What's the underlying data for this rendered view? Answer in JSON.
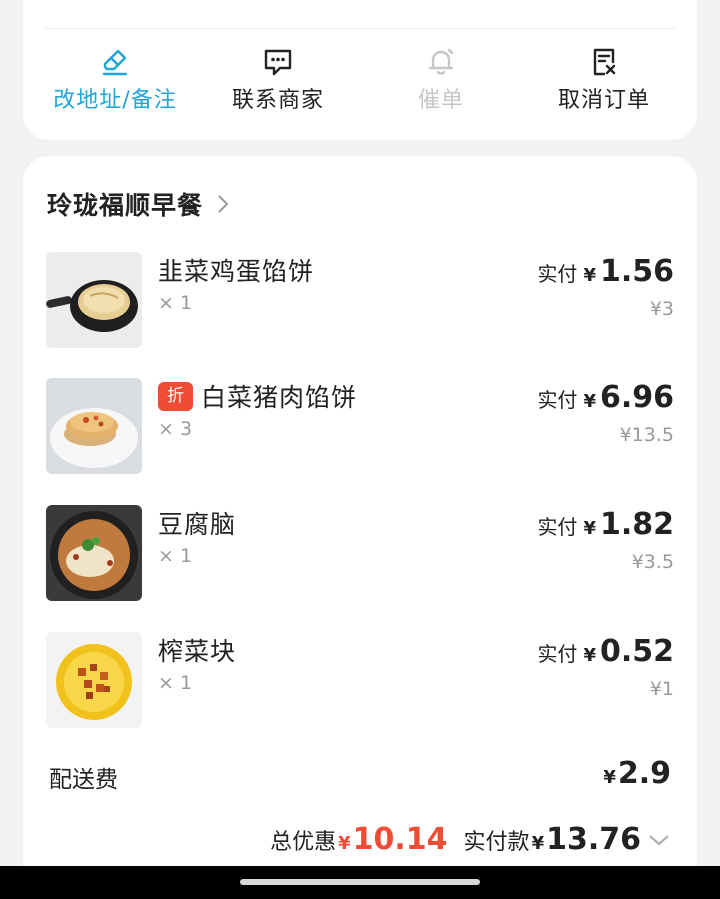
{
  "actions": [
    {
      "label": "改地址/备注",
      "icon": "edit-eraser-icon"
    },
    {
      "label": "联系商家",
      "icon": "chat-bubble-icon"
    },
    {
      "label": "催单",
      "icon": "bell-icon"
    },
    {
      "label": "取消订单",
      "icon": "cancel-document-icon"
    }
  ],
  "store": {
    "name": "玲珑福顺早餐"
  },
  "items": [
    {
      "name": "韭菜鸡蛋馅饼",
      "badge": "",
      "qty": "× 1",
      "paid_label": "实付",
      "paid_currency": "¥",
      "paid_amount": "1.56",
      "original": "¥3"
    },
    {
      "name": "白菜猪肉馅饼",
      "badge": "折",
      "qty": "× 3",
      "paid_label": "实付",
      "paid_currency": "¥",
      "paid_amount": "6.96",
      "original": "¥13.5"
    },
    {
      "name": "豆腐脑",
      "badge": "",
      "qty": "× 1",
      "paid_label": "实付",
      "paid_currency": "¥",
      "paid_amount": "1.82",
      "original": "¥3.5"
    },
    {
      "name": "榨菜块",
      "badge": "",
      "qty": "× 1",
      "paid_label": "实付",
      "paid_currency": "¥",
      "paid_amount": "0.52",
      "original": "¥1"
    }
  ],
  "delivery": {
    "label": "配送费",
    "currency": "¥",
    "amount": "2.9"
  },
  "summary": {
    "discount_label": "总优惠",
    "discount_currency": "¥",
    "discount_amount": "10.14",
    "paid_label": "实付款",
    "paid_currency": "¥",
    "paid_amount": "13.76"
  },
  "colors": {
    "accent": "#21a6d6",
    "discount": "#f04b35",
    "disabled": "#c6c6c6"
  }
}
